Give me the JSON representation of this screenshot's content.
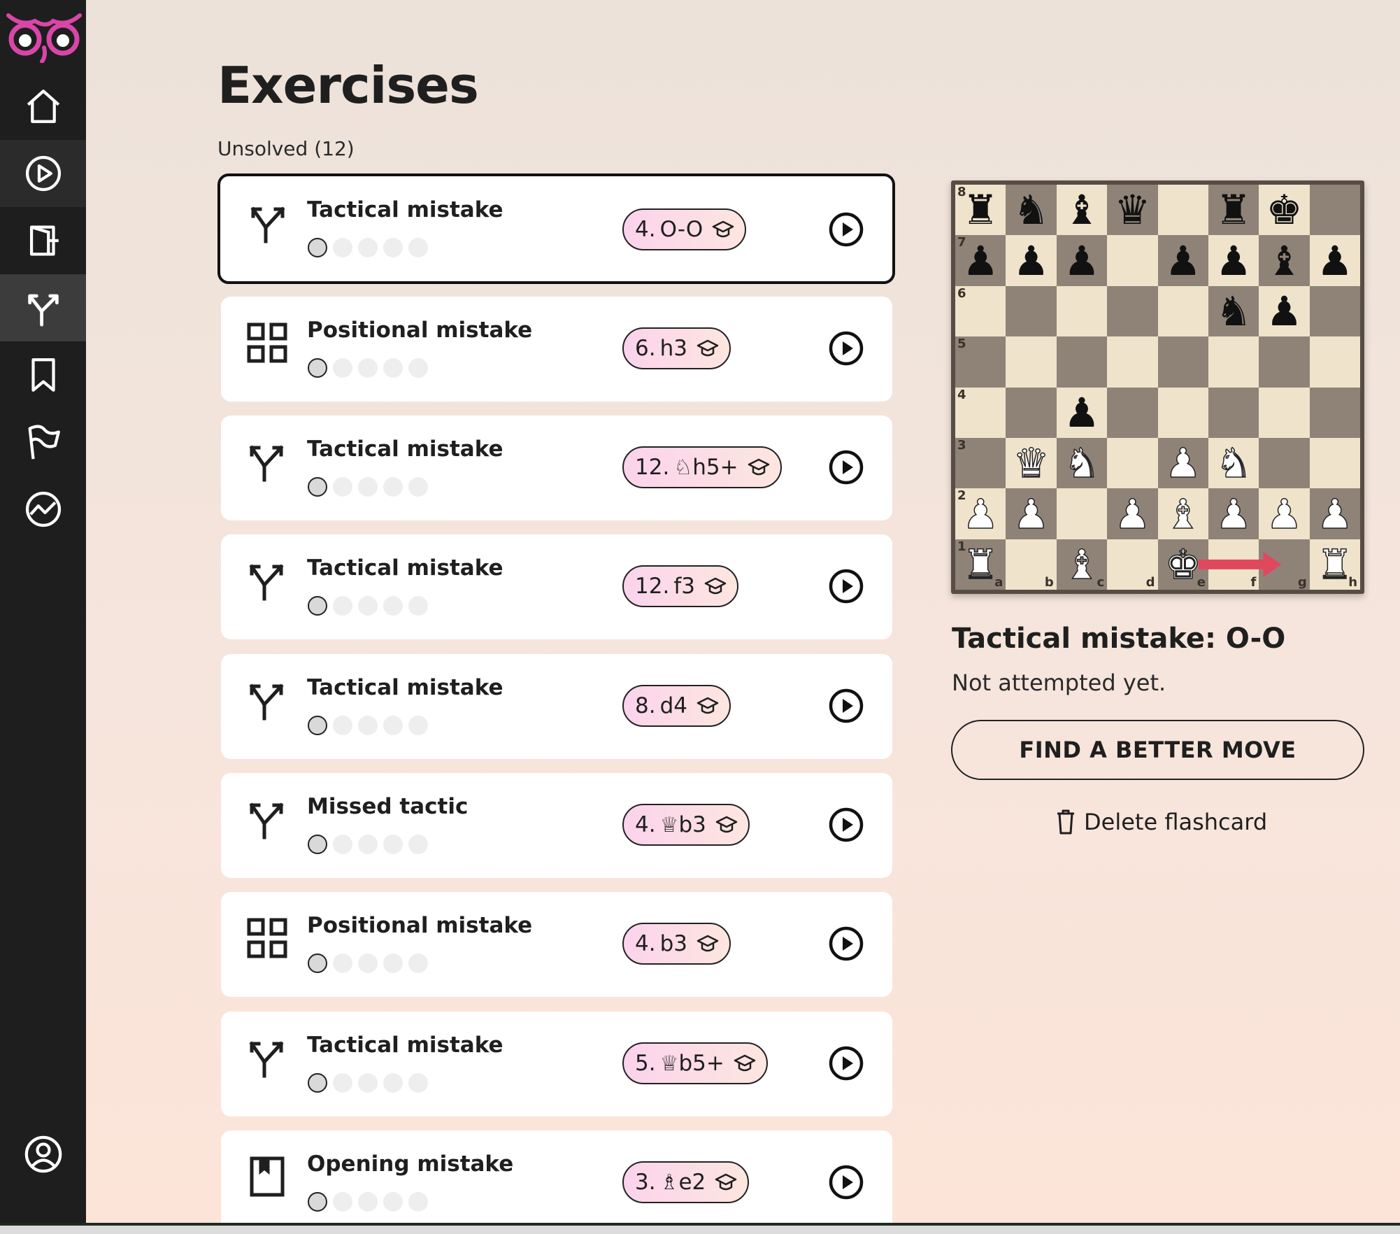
{
  "page": {
    "title": "Exercises",
    "section_label": "Unsolved (12)"
  },
  "sidebar": {
    "items": [
      {
        "name": "home-icon"
      },
      {
        "name": "play-icon"
      },
      {
        "name": "import-icon"
      },
      {
        "name": "exercises-icon",
        "active": true
      },
      {
        "name": "bookmark-icon"
      },
      {
        "name": "flag-icon"
      },
      {
        "name": "insights-icon"
      }
    ],
    "bottom": {
      "name": "account-icon"
    }
  },
  "exercises": [
    {
      "type": "Tactical mistake",
      "icon": "fork-arrow-icon",
      "move_number": "4.",
      "piece": "",
      "move": "O-O",
      "progress": 0,
      "selected": true
    },
    {
      "type": "Positional mistake",
      "icon": "grid-icon",
      "move_number": "6.",
      "piece": "",
      "move": "h3",
      "progress": 0
    },
    {
      "type": "Tactical mistake",
      "icon": "fork-arrow-icon",
      "move_number": "12.",
      "piece": "♘",
      "move": "h5+",
      "progress": 0
    },
    {
      "type": "Tactical mistake",
      "icon": "fork-arrow-icon",
      "move_number": "12.",
      "piece": "",
      "move": "f3",
      "progress": 0
    },
    {
      "type": "Tactical mistake",
      "icon": "fork-arrow-icon",
      "move_number": "8.",
      "piece": "",
      "move": "d4",
      "progress": 0
    },
    {
      "type": "Missed tactic",
      "icon": "fork-arrow-icon",
      "move_number": "4.",
      "piece": "♕",
      "move": "b3",
      "progress": 0
    },
    {
      "type": "Positional mistake",
      "icon": "grid-icon",
      "move_number": "4.",
      "piece": "",
      "move": "b3",
      "progress": 0
    },
    {
      "type": "Tactical mistake",
      "icon": "fork-arrow-icon",
      "move_number": "5.",
      "piece": "♕",
      "move": "b5+",
      "progress": 0
    },
    {
      "type": "Opening mistake",
      "icon": "book-icon",
      "move_number": "3.",
      "piece": "♗",
      "move": "e2",
      "progress": 0
    }
  ],
  "board": {
    "position": [
      [
        "r",
        "n",
        "b",
        "q",
        "",
        "r",
        "k",
        ""
      ],
      [
        "p",
        "p",
        "p",
        "",
        "p",
        "p",
        "b",
        "p"
      ],
      [
        "",
        "",
        "",
        "",
        "",
        "n",
        "p",
        ""
      ],
      [
        "",
        "",
        "",
        "",
        "",
        "",
        "",
        ""
      ],
      [
        "",
        "",
        "p",
        "",
        "",
        "",
        "",
        ""
      ],
      [
        "",
        "Q",
        "N",
        "",
        "P",
        "N",
        "",
        ""
      ],
      [
        "P",
        "P",
        "",
        "P",
        "B",
        "P",
        "P",
        "P"
      ],
      [
        "R",
        "",
        "B",
        "",
        "K",
        "",
        "",
        "R"
      ]
    ],
    "ranks": [
      "8",
      "7",
      "6",
      "5",
      "4",
      "3",
      "2",
      "1"
    ],
    "files": [
      "a",
      "b",
      "c",
      "d",
      "e",
      "f",
      "g",
      "h"
    ],
    "arrow": {
      "from": "e1",
      "to": "g1",
      "color": "#e0485e"
    }
  },
  "detail": {
    "title": "Tactical mistake: O-O",
    "status": "Not attempted yet.",
    "primary_button": "FIND A BETTER MOVE",
    "delete_label": "Delete flashcard"
  },
  "colors": {
    "accent_pink": "#fbd3ec",
    "logo_pink": "#d946a8",
    "light_square": "#efe3cb",
    "dark_square": "#8f8378"
  }
}
